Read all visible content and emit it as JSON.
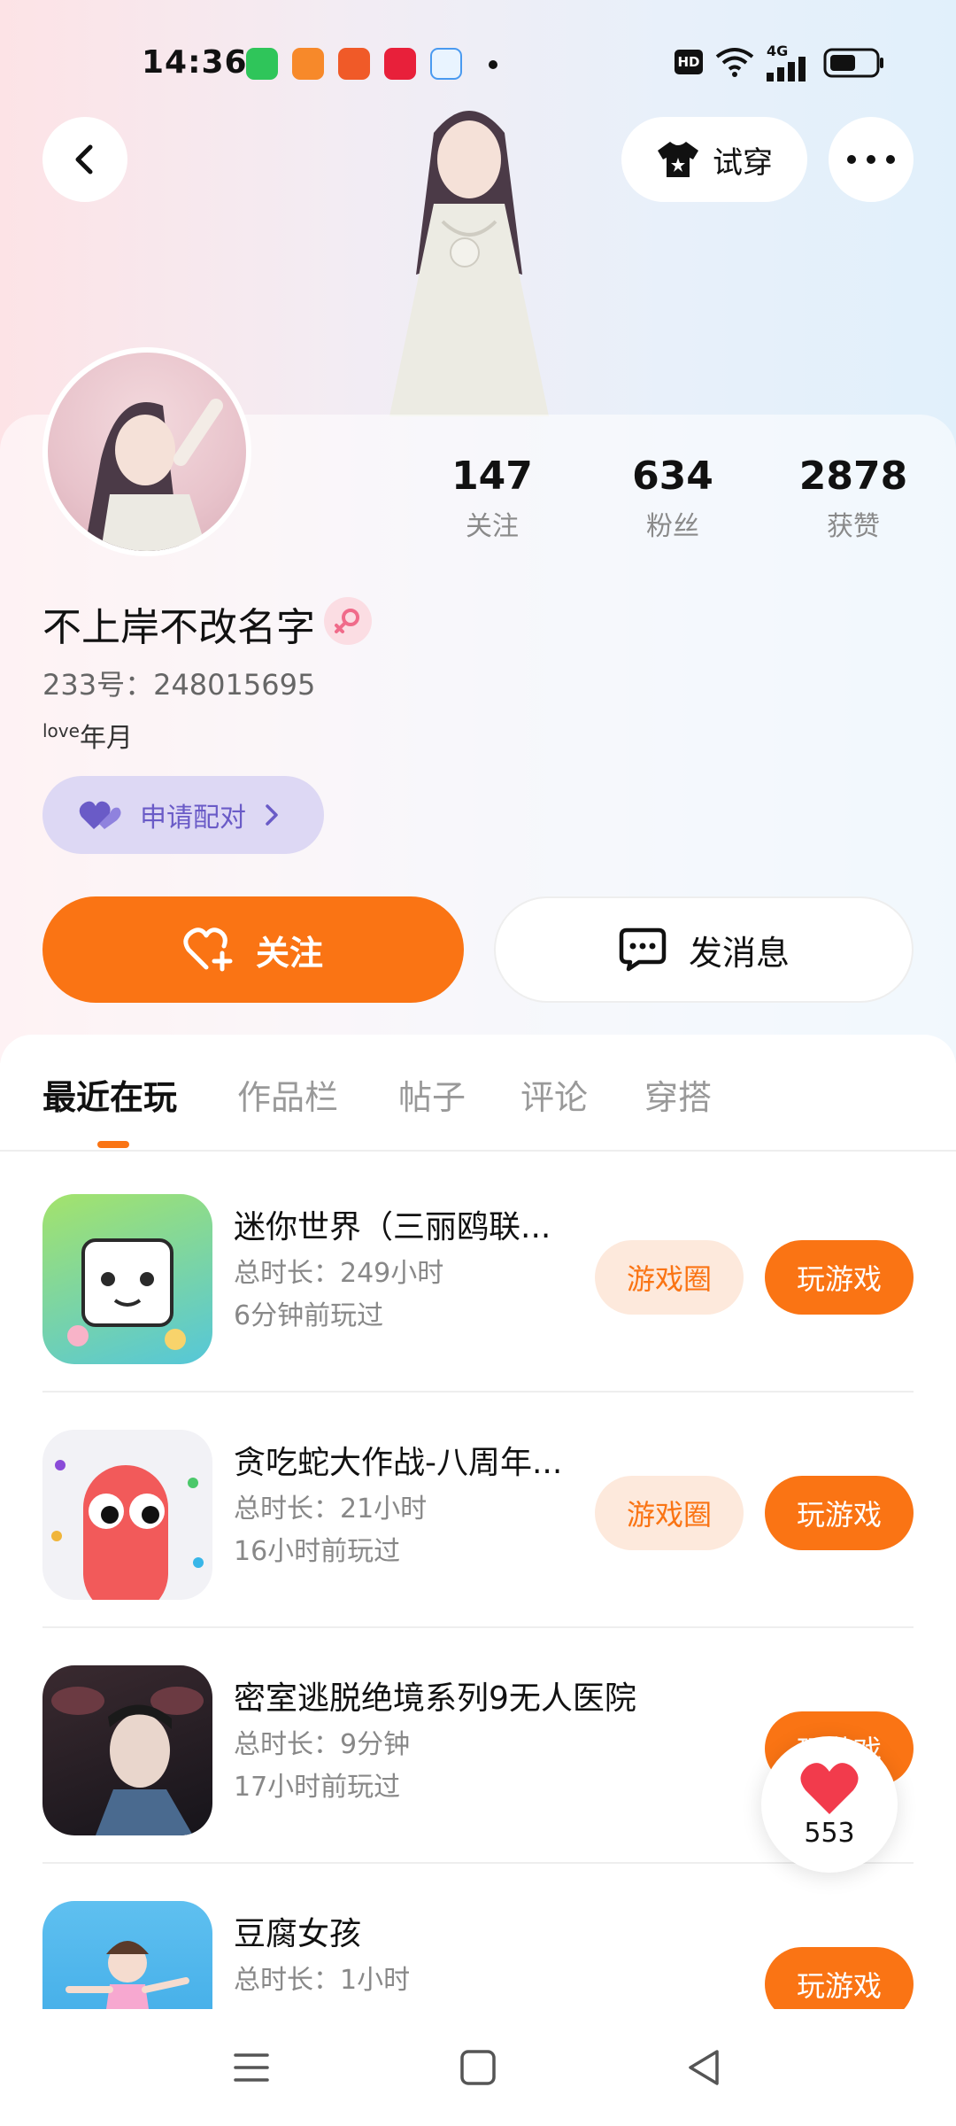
{
  "status_bar": {
    "time": "14:36",
    "hd": "HD",
    "network": "4G"
  },
  "header": {
    "try_on_label": "试穿"
  },
  "profile": {
    "stats": [
      {
        "value": "147",
        "label": "关注"
      },
      {
        "value": "634",
        "label": "粉丝"
      },
      {
        "value": "2878",
        "label": "获赞"
      }
    ],
    "username": "不上岸不改名字",
    "uid": "233号：248015695",
    "bio_sup": "love",
    "bio_text": "年月",
    "match_label": "申请配对"
  },
  "actions": {
    "follow_label": "关注",
    "message_label": "发消息"
  },
  "tabs": [
    {
      "label": "最近在玩",
      "active": true
    },
    {
      "label": "作品栏",
      "active": false
    },
    {
      "label": "帖子",
      "active": false
    },
    {
      "label": "评论",
      "active": false
    },
    {
      "label": "穿搭",
      "active": false
    }
  ],
  "games": [
    {
      "title": "迷你世界（三丽鸥联...",
      "time": "总时长：249小时",
      "last": "6分钟前玩过",
      "circle": "游戏圈",
      "play": "玩游戏"
    },
    {
      "title": "贪吃蛇大作战-八周年...",
      "time": "总时长：21小时",
      "last": "16小时前玩过",
      "circle": "游戏圈",
      "play": "玩游戏"
    },
    {
      "title": "密室逃脱绝境系列9无人医院",
      "time": "总时长：9分钟",
      "last": "17小时前玩过",
      "play": "玩游戏"
    },
    {
      "title": "豆腐女孩",
      "time": "总时长：1小时",
      "play": "玩游戏"
    }
  ],
  "like_float": {
    "count": "553"
  },
  "colors": {
    "accent": "#fa7414",
    "match": "#6a5bc7"
  }
}
